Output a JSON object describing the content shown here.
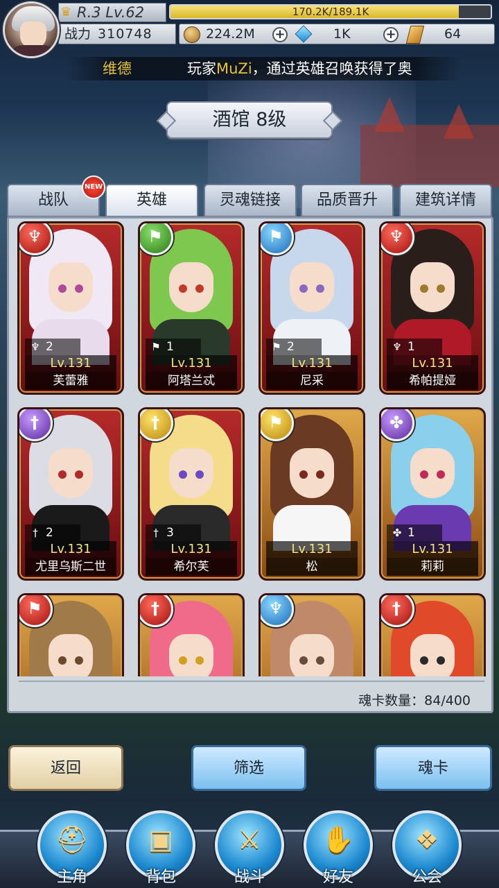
{
  "player": {
    "rank_level": "R.3 Lv.62",
    "exp_text": "170.2K/189.1K",
    "exp_fraction": 0.9,
    "power_label": "战力",
    "power_value": "310748"
  },
  "currency": {
    "gold": "224.2M",
    "gems": "1K",
    "scrolls": "64"
  },
  "ticker": {
    "name": "维德",
    "prefix": "玩家",
    "player_name": "MuZi",
    "suffix": "，通过英雄召唤获得了奥"
  },
  "title": "酒馆 8级",
  "tabs": [
    {
      "label": "战队",
      "badge": "NEW"
    },
    {
      "label": "英雄"
    },
    {
      "label": "灵魂链接"
    },
    {
      "label": "品质晋升"
    },
    {
      "label": "建筑详情"
    }
  ],
  "heroes": [
    {
      "name": "芙蕾雅",
      "level": "Lv.131",
      "count": "2",
      "element": "fire",
      "icon": "winged-crest-icon"
    },
    {
      "name": "阿塔兰忒",
      "level": "Lv.131",
      "count": "1",
      "element": "wind",
      "icon": "banner-icon"
    },
    {
      "name": "尼采",
      "level": "Lv.131",
      "count": "2",
      "element": "water",
      "icon": "banner-icon"
    },
    {
      "name": "希帕提娅",
      "level": "Lv.131",
      "count": "1",
      "element": "fire",
      "icon": "winged-crest-icon"
    },
    {
      "name": "尤里乌斯二世",
      "level": "Lv.131",
      "count": "2",
      "element": "dark",
      "icon": "sword-icon"
    },
    {
      "name": "希尔芙",
      "level": "Lv.131",
      "count": "3",
      "element": "light",
      "icon": "sword-icon"
    },
    {
      "name": "松",
      "level": "Lv.131",
      "count": "",
      "element": "light",
      "icon": "banner-icon"
    },
    {
      "name": "莉莉",
      "level": "Lv.131",
      "count": "1",
      "element": "dark",
      "icon": "shuriken-icon"
    },
    {
      "element": "fire",
      "icon": "banner-icon"
    },
    {
      "element": "fire",
      "icon": "sword-icon"
    },
    {
      "element": "water",
      "icon": "winged-crest-icon"
    },
    {
      "element": "fire",
      "icon": "sword-icon"
    }
  ],
  "soul_count": "魂卡数量：84/400",
  "buttons": {
    "back": "返回",
    "filter": "筛选",
    "soul_card": "魂卡"
  },
  "nav": [
    {
      "label": "主角",
      "icon": "helmet-icon"
    },
    {
      "label": "背包",
      "icon": "backpack-icon"
    },
    {
      "label": "战斗",
      "icon": "crossed-swords-icon"
    },
    {
      "label": "好友",
      "icon": "handshake-icon"
    },
    {
      "label": "公会",
      "icon": "guild-crest-icon"
    }
  ],
  "colors": {
    "level_text": "#f6e47a",
    "ticker_highlight": "#e8c33a",
    "nav_blue": "#1e8ad0"
  }
}
